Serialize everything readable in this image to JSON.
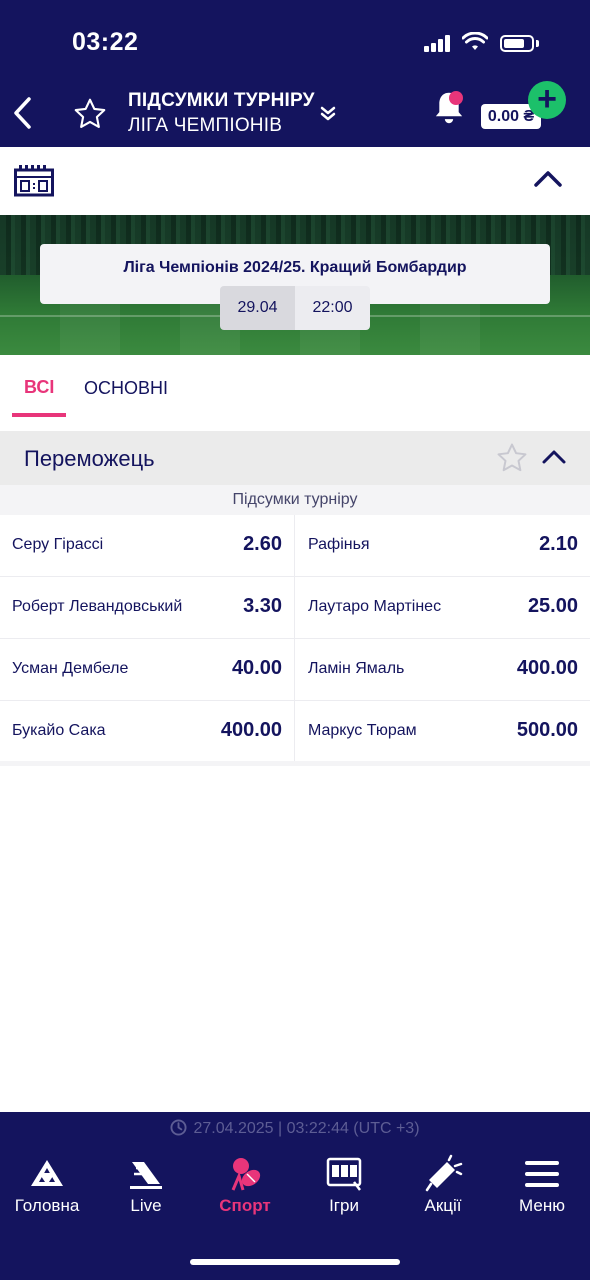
{
  "status_bar": {
    "time": "03:22"
  },
  "header": {
    "title": "ПІДСУМКИ ТУРНІРУ",
    "subtitle": "ЛІГА ЧЕМПІОНІВ",
    "balance": "0.00 ₴",
    "icons": [
      "back-icon",
      "star-icon",
      "chevron-double-down-icon",
      "bell-icon",
      "plus-icon"
    ]
  },
  "event": {
    "title": "Ліга Чемпіонів 2024/25. Кращий Бомбардир",
    "date": "29.04",
    "time": "22:00"
  },
  "tabs": [
    {
      "label": "ВСІ",
      "active": true
    },
    {
      "label": "ОСНОВНІ",
      "active": false
    }
  ],
  "market": {
    "title": "Переможець",
    "subtitle": "Підсумки турніру",
    "rows": [
      [
        {
          "name": "Серу Гірассі",
          "odd": "2.60"
        },
        {
          "name": "Рафінья",
          "odd": "2.10"
        }
      ],
      [
        {
          "name": "Роберт Левандовський",
          "odd": "3.30"
        },
        {
          "name": "Лаутаро Мартінес",
          "odd": "25.00"
        }
      ],
      [
        {
          "name": "Усман Дембеле",
          "odd": "40.00"
        },
        {
          "name": "Ламін Ямаль",
          "odd": "400.00"
        }
      ],
      [
        {
          "name": "Букайо Сака",
          "odd": "400.00"
        },
        {
          "name": "Маркус Тюрам",
          "odd": "500.00"
        }
      ]
    ]
  },
  "footer": {
    "timestamp": "27.04.2025 | 03:22:44 (UTC +3)",
    "nav": [
      {
        "label": "Головна",
        "icon": "home-icon",
        "active": false
      },
      {
        "label": "Live",
        "icon": "live-icon",
        "active": false
      },
      {
        "label": "Спорт",
        "icon": "sport-icon",
        "active": true
      },
      {
        "label": "Ігри",
        "icon": "games-icon",
        "active": false
      },
      {
        "label": "Акції",
        "icon": "promo-icon",
        "active": false
      },
      {
        "label": "Меню",
        "icon": "menu-icon",
        "active": false
      }
    ]
  },
  "colors": {
    "navy": "#14145e",
    "accent": "#e8357a",
    "green": "#1cc06a"
  }
}
